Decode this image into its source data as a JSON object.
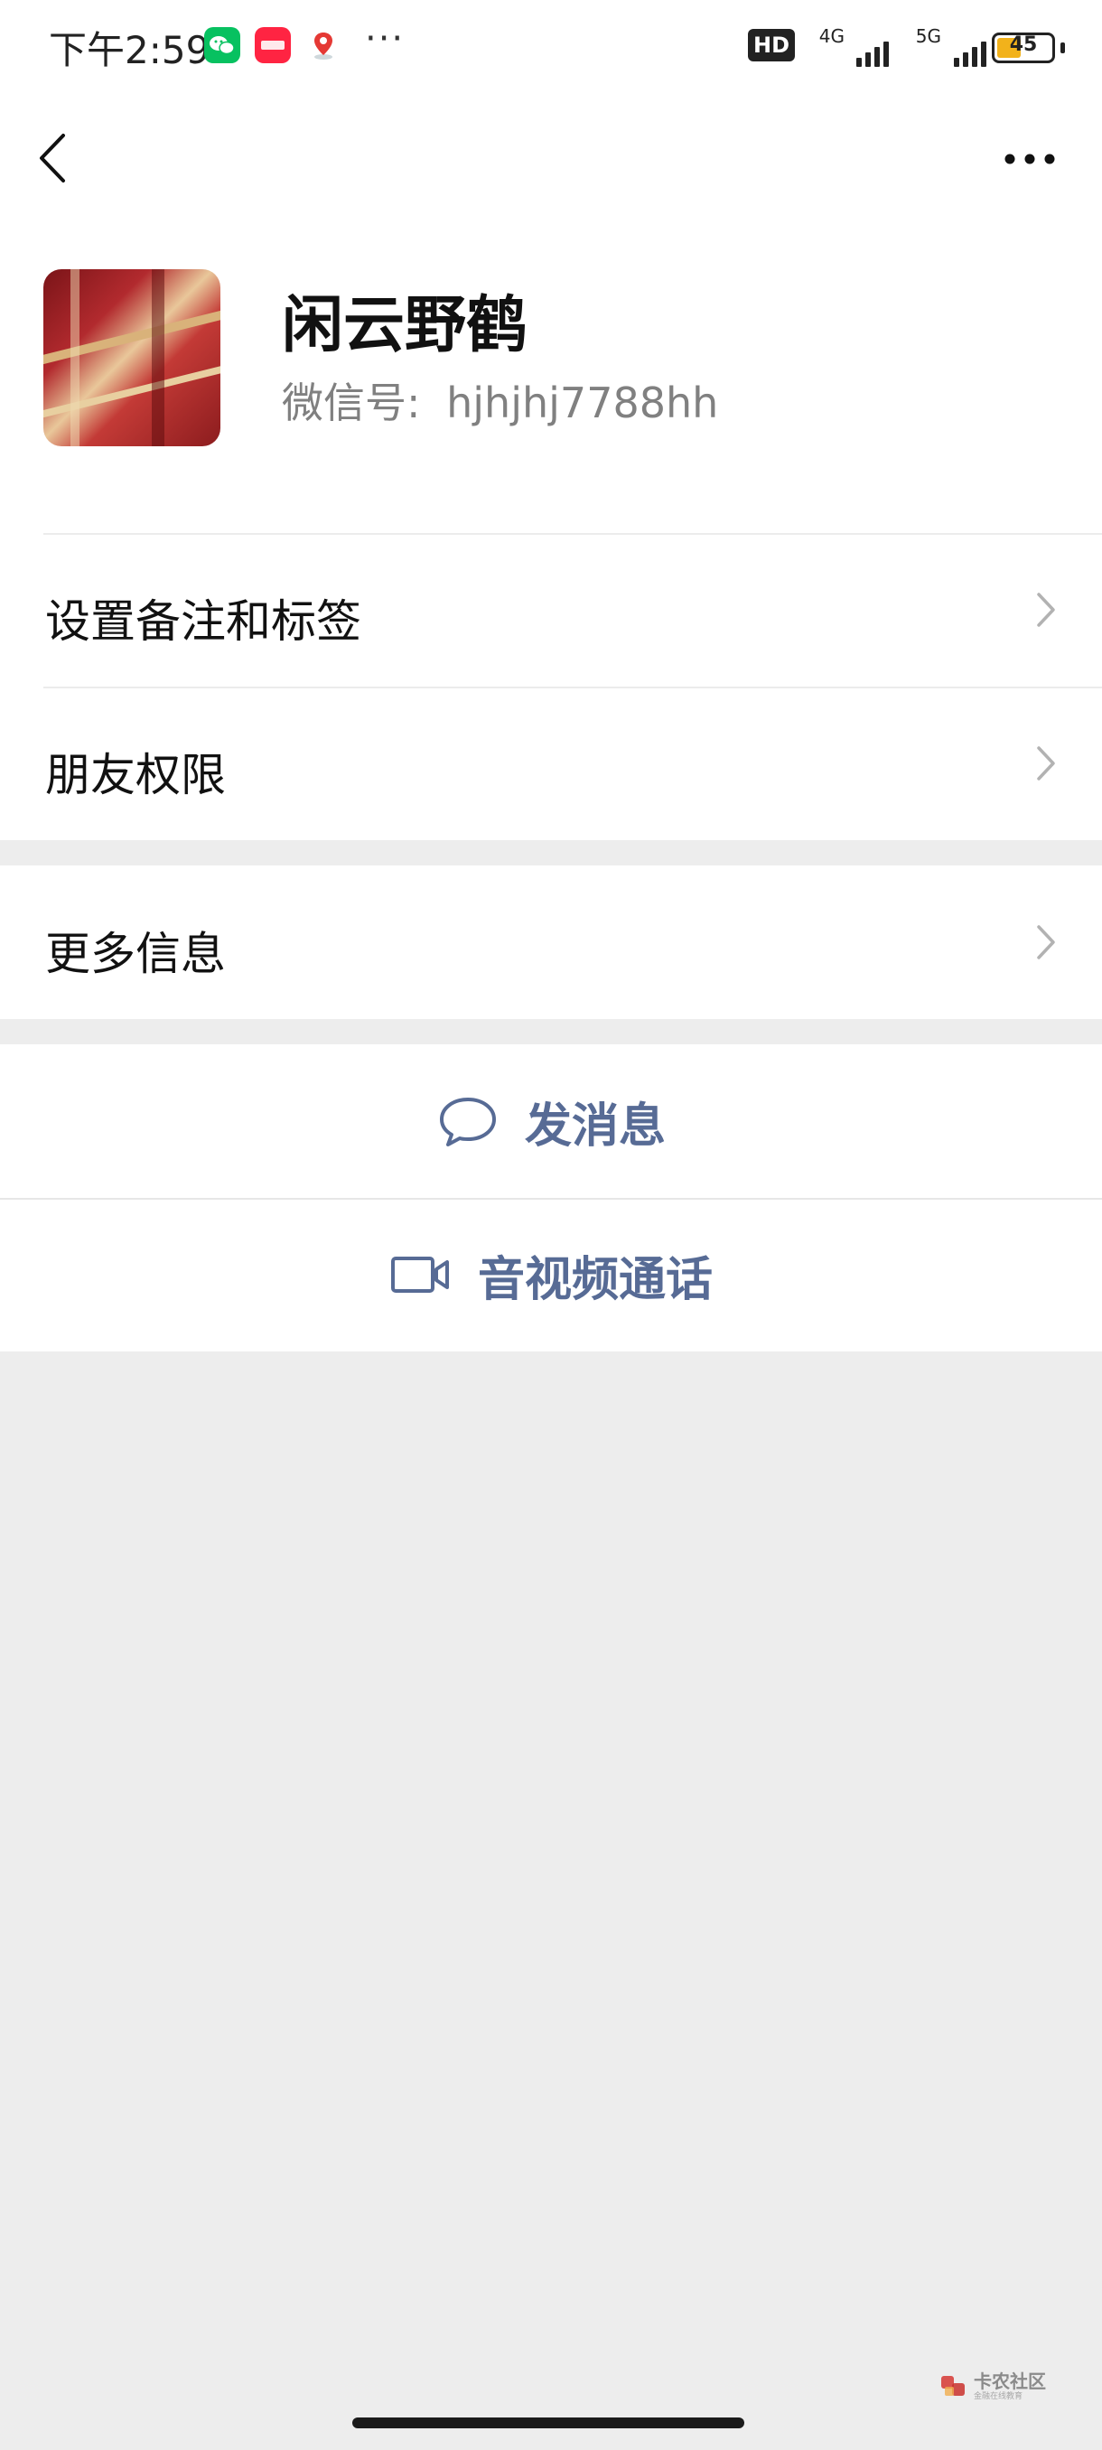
{
  "status_bar": {
    "time": "下午2:59",
    "icons": [
      "wechat-icon",
      "xiaohongshu-icon",
      "map-pin-icon"
    ],
    "more": "···",
    "hd": "HD",
    "net_1": "4G",
    "net_2": "5G",
    "battery_level": "45",
    "battery_color": "#f2b21b"
  },
  "nav": {
    "back_icon": "back-arrow-icon",
    "more_icon": "more-dots-icon"
  },
  "profile": {
    "nickname": "闲云野鹤",
    "wechat_id_label": "微信号:",
    "wechat_id": "hjhjhj7788hh"
  },
  "rows": {
    "remark": "设置备注和标签",
    "permissions": "朋友权限",
    "more_info": "更多信息"
  },
  "actions": {
    "message": "发消息",
    "call": "音视频通话",
    "accent_color": "#576b95"
  },
  "watermark": {
    "title": "卡农社区",
    "subtitle": "金融在线教育"
  }
}
